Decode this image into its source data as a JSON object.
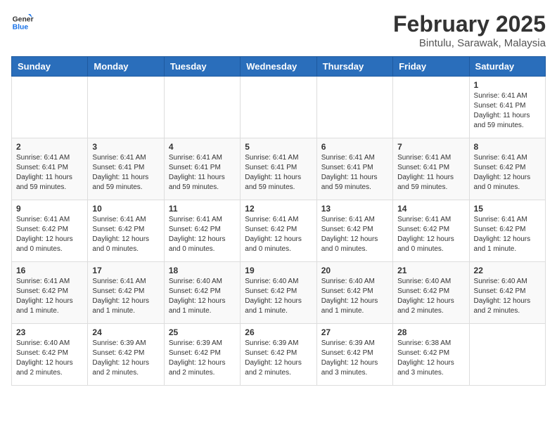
{
  "logo": {
    "line1": "General",
    "line2": "Blue"
  },
  "calendar": {
    "title": "February 2025",
    "subtitle": "Bintulu, Sarawak, Malaysia",
    "days_of_week": [
      "Sunday",
      "Monday",
      "Tuesday",
      "Wednesday",
      "Thursday",
      "Friday",
      "Saturday"
    ],
    "weeks": [
      [
        {
          "day": "",
          "info": ""
        },
        {
          "day": "",
          "info": ""
        },
        {
          "day": "",
          "info": ""
        },
        {
          "day": "",
          "info": ""
        },
        {
          "day": "",
          "info": ""
        },
        {
          "day": "",
          "info": ""
        },
        {
          "day": "1",
          "info": "Sunrise: 6:41 AM\nSunset: 6:41 PM\nDaylight: 11 hours\nand 59 minutes."
        }
      ],
      [
        {
          "day": "2",
          "info": "Sunrise: 6:41 AM\nSunset: 6:41 PM\nDaylight: 11 hours\nand 59 minutes."
        },
        {
          "day": "3",
          "info": "Sunrise: 6:41 AM\nSunset: 6:41 PM\nDaylight: 11 hours\nand 59 minutes."
        },
        {
          "day": "4",
          "info": "Sunrise: 6:41 AM\nSunset: 6:41 PM\nDaylight: 11 hours\nand 59 minutes."
        },
        {
          "day": "5",
          "info": "Sunrise: 6:41 AM\nSunset: 6:41 PM\nDaylight: 11 hours\nand 59 minutes."
        },
        {
          "day": "6",
          "info": "Sunrise: 6:41 AM\nSunset: 6:41 PM\nDaylight: 11 hours\nand 59 minutes."
        },
        {
          "day": "7",
          "info": "Sunrise: 6:41 AM\nSunset: 6:41 PM\nDaylight: 11 hours\nand 59 minutes."
        },
        {
          "day": "8",
          "info": "Sunrise: 6:41 AM\nSunset: 6:42 PM\nDaylight: 12 hours\nand 0 minutes."
        }
      ],
      [
        {
          "day": "9",
          "info": "Sunrise: 6:41 AM\nSunset: 6:42 PM\nDaylight: 12 hours\nand 0 minutes."
        },
        {
          "day": "10",
          "info": "Sunrise: 6:41 AM\nSunset: 6:42 PM\nDaylight: 12 hours\nand 0 minutes."
        },
        {
          "day": "11",
          "info": "Sunrise: 6:41 AM\nSunset: 6:42 PM\nDaylight: 12 hours\nand 0 minutes."
        },
        {
          "day": "12",
          "info": "Sunrise: 6:41 AM\nSunset: 6:42 PM\nDaylight: 12 hours\nand 0 minutes."
        },
        {
          "day": "13",
          "info": "Sunrise: 6:41 AM\nSunset: 6:42 PM\nDaylight: 12 hours\nand 0 minutes."
        },
        {
          "day": "14",
          "info": "Sunrise: 6:41 AM\nSunset: 6:42 PM\nDaylight: 12 hours\nand 0 minutes."
        },
        {
          "day": "15",
          "info": "Sunrise: 6:41 AM\nSunset: 6:42 PM\nDaylight: 12 hours\nand 1 minute."
        }
      ],
      [
        {
          "day": "16",
          "info": "Sunrise: 6:41 AM\nSunset: 6:42 PM\nDaylight: 12 hours\nand 1 minute."
        },
        {
          "day": "17",
          "info": "Sunrise: 6:41 AM\nSunset: 6:42 PM\nDaylight: 12 hours\nand 1 minute."
        },
        {
          "day": "18",
          "info": "Sunrise: 6:40 AM\nSunset: 6:42 PM\nDaylight: 12 hours\nand 1 minute."
        },
        {
          "day": "19",
          "info": "Sunrise: 6:40 AM\nSunset: 6:42 PM\nDaylight: 12 hours\nand 1 minute."
        },
        {
          "day": "20",
          "info": "Sunrise: 6:40 AM\nSunset: 6:42 PM\nDaylight: 12 hours\nand 1 minute."
        },
        {
          "day": "21",
          "info": "Sunrise: 6:40 AM\nSunset: 6:42 PM\nDaylight: 12 hours\nand 2 minutes."
        },
        {
          "day": "22",
          "info": "Sunrise: 6:40 AM\nSunset: 6:42 PM\nDaylight: 12 hours\nand 2 minutes."
        }
      ],
      [
        {
          "day": "23",
          "info": "Sunrise: 6:40 AM\nSunset: 6:42 PM\nDaylight: 12 hours\nand 2 minutes."
        },
        {
          "day": "24",
          "info": "Sunrise: 6:39 AM\nSunset: 6:42 PM\nDaylight: 12 hours\nand 2 minutes."
        },
        {
          "day": "25",
          "info": "Sunrise: 6:39 AM\nSunset: 6:42 PM\nDaylight: 12 hours\nand 2 minutes."
        },
        {
          "day": "26",
          "info": "Sunrise: 6:39 AM\nSunset: 6:42 PM\nDaylight: 12 hours\nand 2 minutes."
        },
        {
          "day": "27",
          "info": "Sunrise: 6:39 AM\nSunset: 6:42 PM\nDaylight: 12 hours\nand 3 minutes."
        },
        {
          "day": "28",
          "info": "Sunrise: 6:38 AM\nSunset: 6:42 PM\nDaylight: 12 hours\nand 3 minutes."
        },
        {
          "day": "",
          "info": ""
        }
      ]
    ]
  }
}
